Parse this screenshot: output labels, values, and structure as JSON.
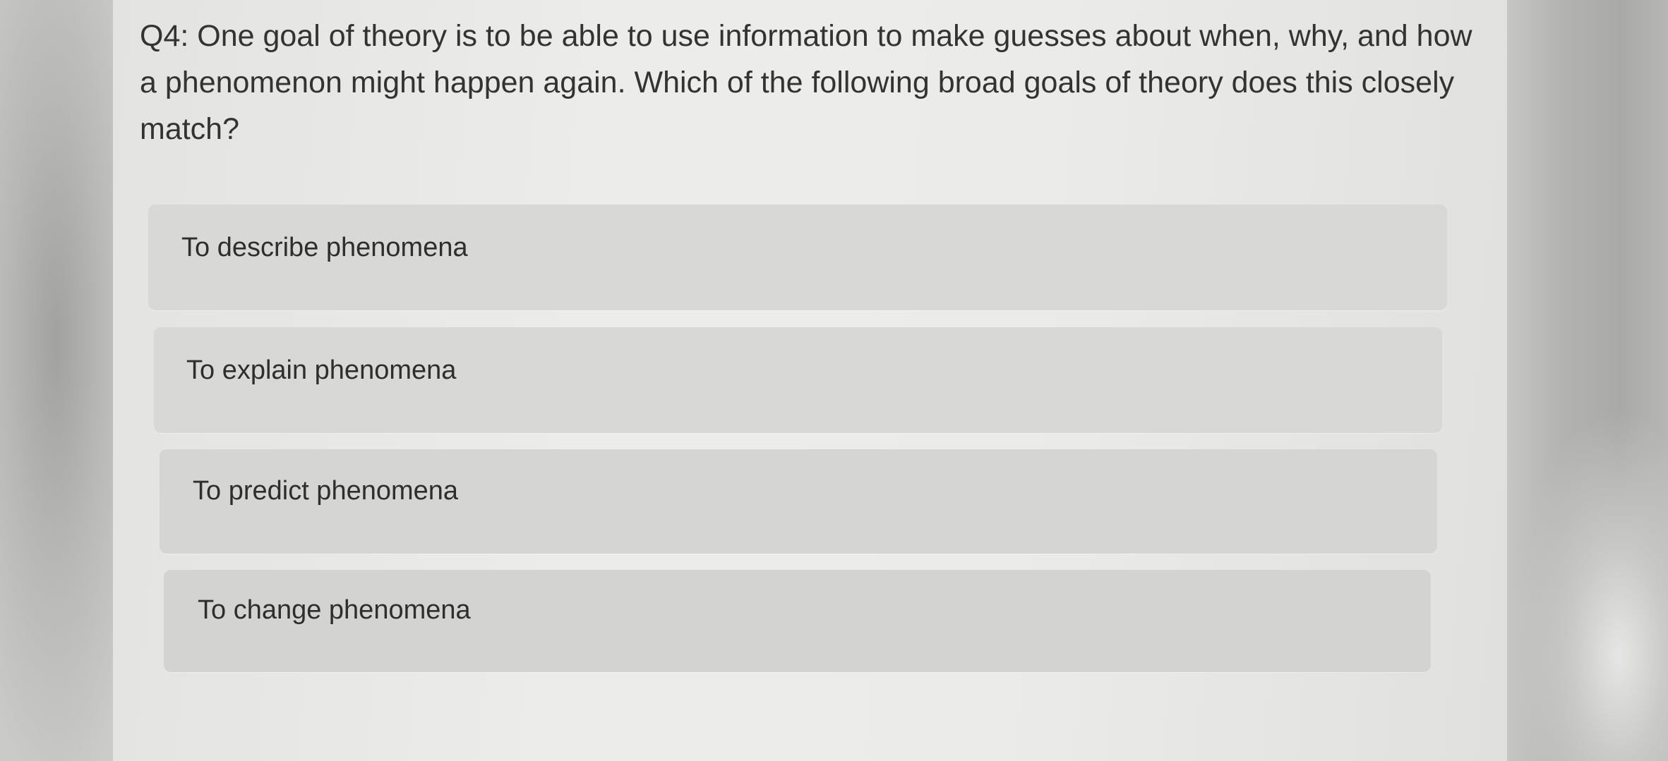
{
  "question": {
    "text": "Q4: One goal of theory is to be able to use information to make guesses about when, why, and how a phenomenon might happen again. Which of the following broad goals of theory does this closely match?"
  },
  "options": [
    {
      "label": "To describe phenomena"
    },
    {
      "label": "To explain phenomena"
    },
    {
      "label": "To predict phenomena"
    },
    {
      "label": "To change phenomena"
    }
  ]
}
